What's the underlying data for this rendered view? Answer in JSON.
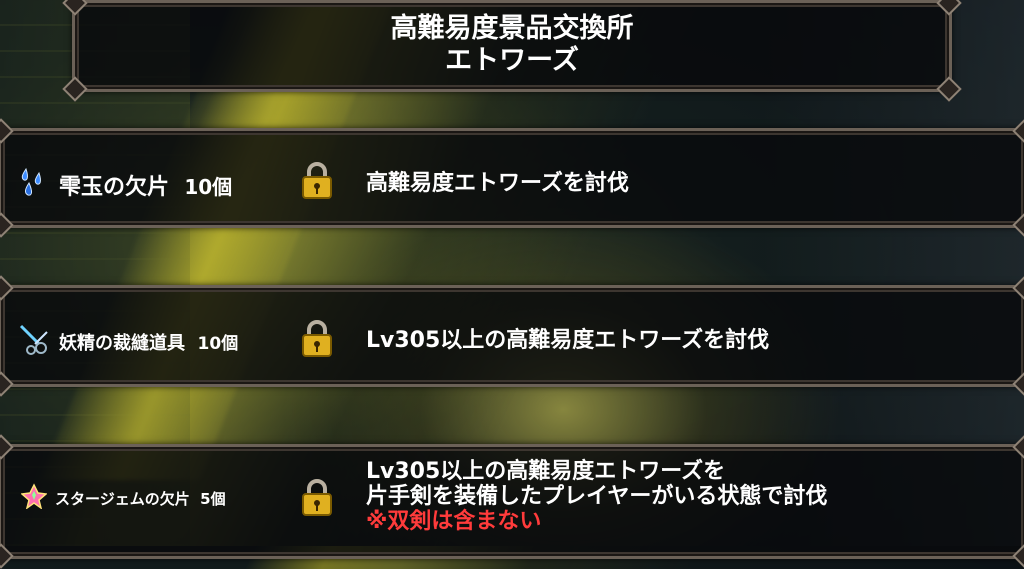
{
  "header": {
    "title_line1": "高難易度景品交換所",
    "title_line2": "エトワーズ"
  },
  "rewards": [
    {
      "item": "雫玉の欠片",
      "count": "10個",
      "icon": "droplet-shards-icon",
      "locked": true,
      "condition": [
        "高難易度エトワーズを討伐"
      ],
      "note": ""
    },
    {
      "item": "妖精の裁縫道具",
      "count": "10個",
      "icon": "sewing-tools-icon",
      "locked": true,
      "condition": [
        "Lv305以上の高難易度エトワーズを討伐"
      ],
      "note": ""
    },
    {
      "item": "スタージェムの欠片",
      "count": "5個",
      "icon": "star-gem-icon",
      "locked": true,
      "condition": [
        "Lv305以上の高難易度エトワーズを",
        "片手剣を装備したプレイヤーがいる状態で討伐"
      ],
      "note": "※双剣は含まない"
    }
  ],
  "colors": {
    "note_red": "#ff3b3b",
    "frame": "#6b6157",
    "text": "#ffffff"
  }
}
